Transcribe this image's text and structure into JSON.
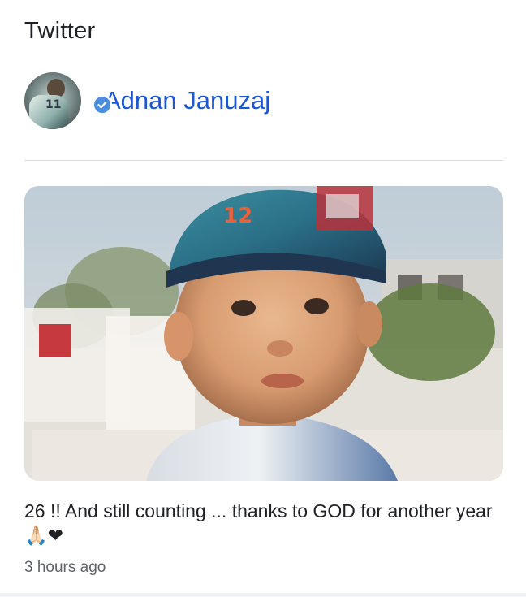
{
  "card": {
    "section_title": "Twitter",
    "author": {
      "name": "Adnan Januzaj",
      "verified": true,
      "avatar_jersey_number": "11"
    },
    "post": {
      "text": "26 !! And still counting ... thanks to GOD for another year",
      "emojis": "🙏🏻❤",
      "timestamp": "3 hours ago",
      "image_cap_text": "12"
    }
  },
  "colors": {
    "author_link": "#1a56d6",
    "verified_badge": "#4a8fe0",
    "text_primary": "#202124",
    "text_secondary": "#5f6368"
  }
}
